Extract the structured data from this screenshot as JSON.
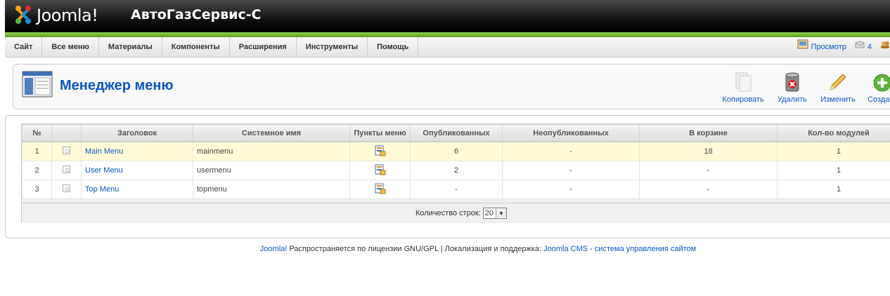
{
  "header": {
    "logo_text": "Joomla!",
    "site_title": "АвтоГазСервис-С"
  },
  "menu": {
    "items": [
      {
        "label": "Сайт"
      },
      {
        "label": "Все меню"
      },
      {
        "label": "Материалы"
      },
      {
        "label": "Компоненты"
      },
      {
        "label": "Расширения"
      },
      {
        "label": "Инструменты"
      },
      {
        "label": "Помощь"
      }
    ]
  },
  "status": {
    "preview_label": "Просмотр",
    "messages_count": "4"
  },
  "page": {
    "title": "Менеджер меню"
  },
  "toolbar": {
    "copy_label": "Копировать",
    "delete_label": "Удалить",
    "edit_label": "Изменить",
    "create_label": "Создать"
  },
  "table": {
    "headers": {
      "num": "№",
      "title": "Заголовок",
      "system_name": "Системное имя",
      "menu_items": "Пункты меню",
      "published": "Опубликованных",
      "unpublished": "Неопубликованных",
      "trash": "В корзине",
      "modules": "Кол-во модулей"
    },
    "rows": [
      {
        "num": "1",
        "title": "Main Menu",
        "system_name": "mainmenu",
        "published": "6",
        "unpublished": "-",
        "trash": "18",
        "modules": "1"
      },
      {
        "num": "2",
        "title": "User Menu",
        "system_name": "usermenu",
        "published": "2",
        "unpublished": "-",
        "trash": "-",
        "modules": "1"
      },
      {
        "num": "3",
        "title": "Top Menu",
        "system_name": "topmenu",
        "published": "-",
        "unpublished": "-",
        "trash": "-",
        "modules": "1"
      }
    ]
  },
  "pager": {
    "label": "Количество строк:",
    "value": "20"
  },
  "footer": {
    "joomla_link": "Joomla!",
    "license_text": " Распространяется по лицензии GNU/GPL | Локализация и поддержка: ",
    "support_link": "Joomla CMS - система управления сайтом"
  },
  "icons": {
    "logo": "joomla-logo-icon",
    "preview": "preview-icon",
    "messages": "messages-icon",
    "users": "users-icon",
    "page": "menu-manager-icon",
    "copy": "copy-icon",
    "delete": "trash-delete-icon",
    "edit": "pencil-edit-icon",
    "create": "plus-create-icon",
    "menu_items": "menu-items-icon"
  }
}
